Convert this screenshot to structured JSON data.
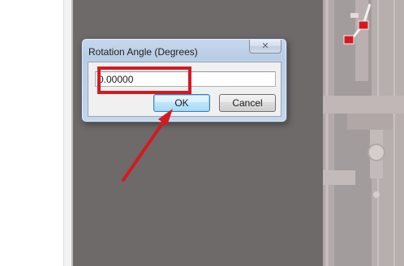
{
  "dialog": {
    "title": "Rotation Angle (Degrees)",
    "close_label": "✕",
    "angle_value": "0.00000",
    "ok_label": "OK",
    "cancel_label": "Cancel"
  },
  "colors": {
    "canvas_background": "#6e6a69",
    "annotation_red": "#d41a20",
    "pcb_background": "#a39c9c"
  },
  "icons": {
    "close": "close-icon",
    "annotation_arrow": "arrow-annotation"
  }
}
